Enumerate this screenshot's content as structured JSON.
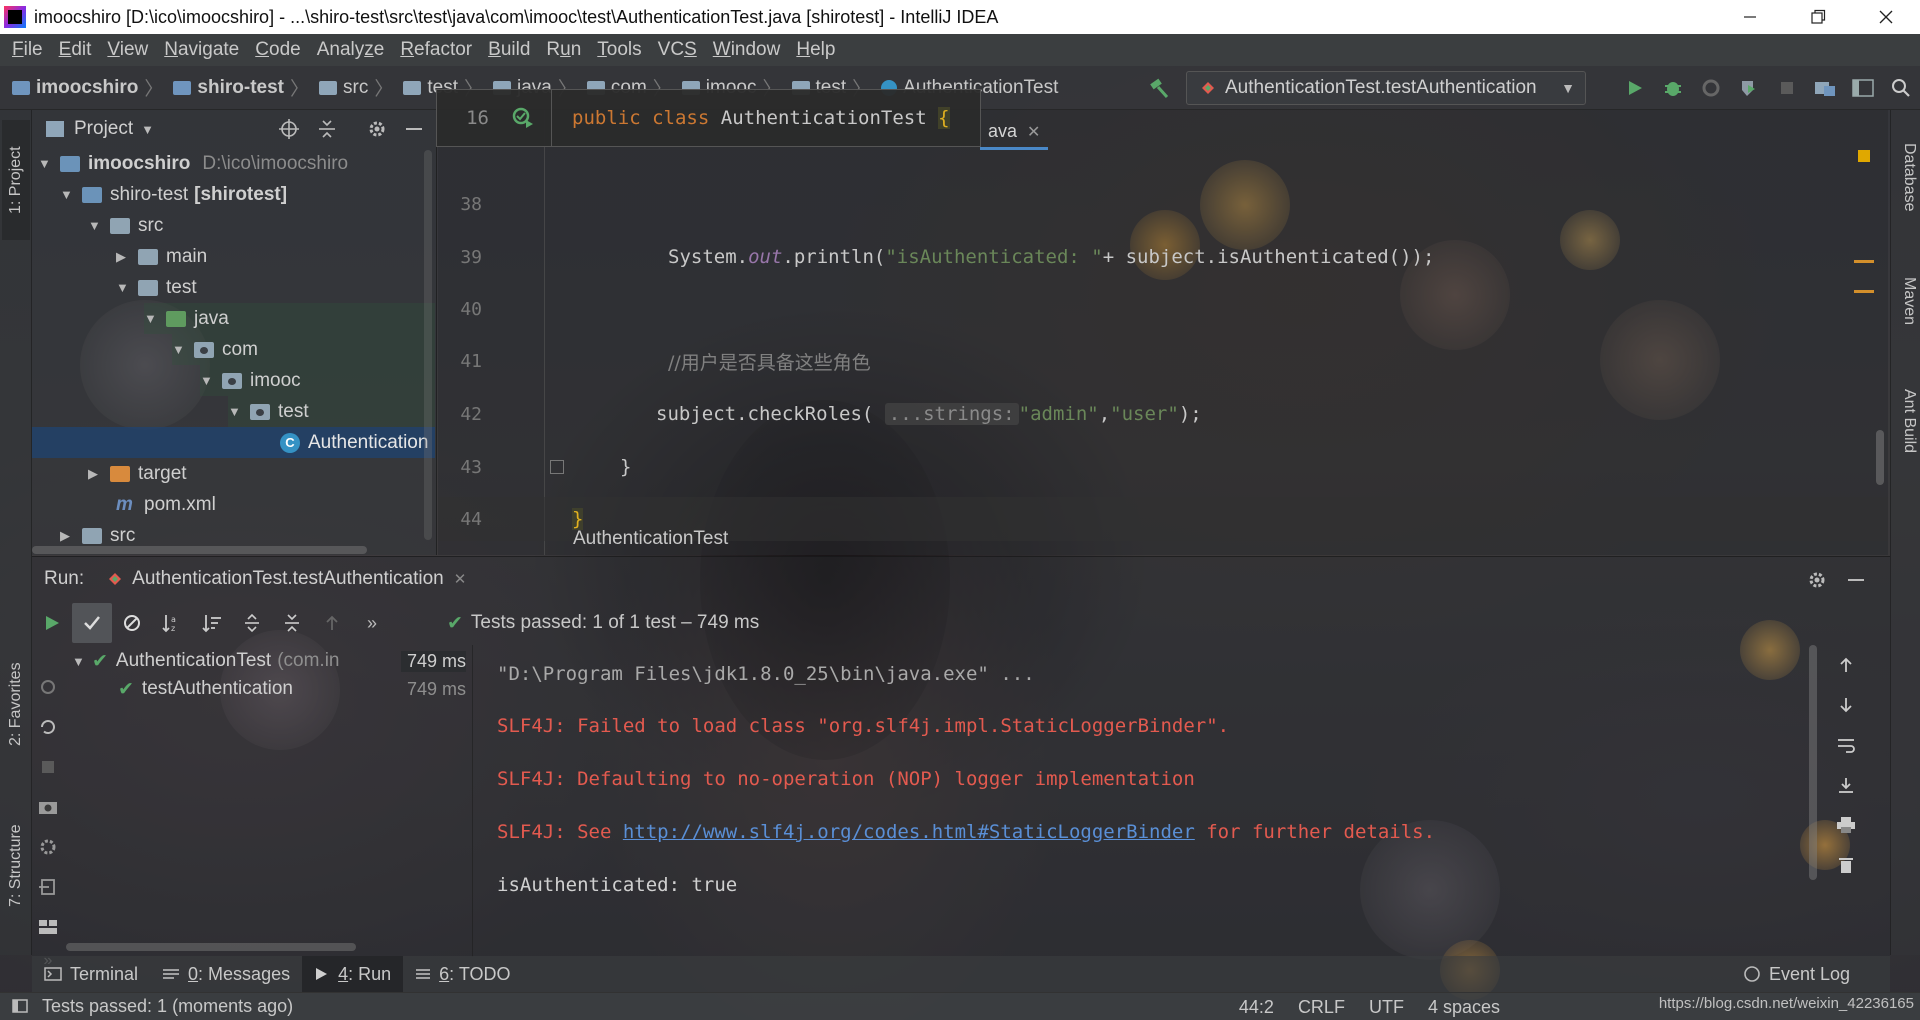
{
  "window": {
    "title": "imoocshiro [D:\\ico\\imoocshiro] - ...\\shiro-test\\src\\test\\java\\com\\imooc\\test\\AuthenticationTest.java [shirotest] - IntelliJ IDEA"
  },
  "menu": [
    {
      "mnemonic": "F",
      "rest": "ile"
    },
    {
      "mnemonic": "E",
      "rest": "dit"
    },
    {
      "mnemonic": "V",
      "rest": "iew"
    },
    {
      "mnemonic": "N",
      "rest": "avigate"
    },
    {
      "mnemonic": "C",
      "rest": "ode"
    },
    {
      "pre": "Analy",
      "mnemonic": "z",
      "rest": "e"
    },
    {
      "mnemonic": "R",
      "rest": "efactor"
    },
    {
      "mnemonic": "B",
      "rest": "uild"
    },
    {
      "pre": "R",
      "mnemonic": "u",
      "rest": "n"
    },
    {
      "mnemonic": "T",
      "rest": "ools"
    },
    {
      "pre": "VC",
      "mnemonic": "S",
      "rest": ""
    },
    {
      "mnemonic": "W",
      "rest": "indow"
    },
    {
      "mnemonic": "H",
      "rest": "elp"
    }
  ],
  "breadcrumbs": [
    "imoocshiro",
    "shiro-test",
    "src",
    "test",
    "java",
    "com",
    "imooc",
    "test",
    "AuthenticationTest"
  ],
  "run_config": "AuthenticationTest.testAuthentication",
  "left_tabs": {
    "project": "1: Project",
    "favorites": "2: Favorites",
    "structure": "7: Structure"
  },
  "right_tabs": {
    "database": "Database",
    "maven": "Maven",
    "ant": "Ant Build"
  },
  "project_panel": {
    "title": "Project",
    "tree": [
      {
        "label": "imoocshiro",
        "extra": "D:\\ico\\imoocshiro"
      },
      {
        "label": "shiro-test",
        "extra": "[shirotest]"
      },
      {
        "label": "src"
      },
      {
        "label": "main"
      },
      {
        "label": "test"
      },
      {
        "label": "java"
      },
      {
        "label": "com"
      },
      {
        "label": "imooc"
      },
      {
        "label": "test"
      },
      {
        "label": "Authentication"
      },
      {
        "label": "target"
      },
      {
        "label": "pom.xml"
      },
      {
        "label": "src"
      }
    ]
  },
  "editor": {
    "tab": "ava",
    "sticky": {
      "line": "16",
      "code": {
        "kw1": "public",
        "kw2": "class",
        "name": "AuthenticationTest",
        "brace": "{"
      }
    },
    "lines": [
      {
        "n": "38"
      },
      {
        "n": "39",
        "a": "System.",
        "b": "out",
        "c": ".println(",
        "d": "\"isAuthenticated: \"",
        "e": "+ subject.isAuthenticated());"
      },
      {
        "n": "40"
      },
      {
        "n": "41",
        "comment": "//用户是否具备这些角色"
      },
      {
        "n": "42",
        "a": "subject.checkRoles(",
        "hint": "...strings:",
        "s1": "\"admin\"",
        "comma": ",",
        "s2": "\"user\"",
        "end": ");"
      },
      {
        "n": "43",
        "code": "}"
      },
      {
        "n": "44",
        "code": "}"
      }
    ],
    "breadcrumb": "AuthenticationTest"
  },
  "run_panel": {
    "label": "Run:",
    "tab": "AuthenticationTest.testAuthentication",
    "status": "Tests passed: 1 of 1 test – 749 ms",
    "tree": [
      {
        "label": "AuthenticationTest",
        "extra": "(com.in",
        "ms": "749 ms"
      },
      {
        "label": "testAuthentication",
        "ms": "749 ms"
      }
    ],
    "console": {
      "cmd": "\"D:\\Program Files\\jdk1.8.0_25\\bin\\java.exe\" ...",
      "err1": "SLF4J: Failed to load class \"org.slf4j.impl.StaticLoggerBinder\".",
      "err2": "SLF4J: Defaulting to no-operation (NOP) logger implementation",
      "err3_pre": "SLF4J: See ",
      "err3_link": "http://www.slf4j.org/codes.html#StaticLoggerBinder",
      "err3_post": " for further details.",
      "out": "isAuthenticated: true"
    }
  },
  "bottom_tabs": [
    {
      "label": "Terminal"
    },
    {
      "num": "0",
      "label": ": Messages"
    },
    {
      "num": "4",
      "label": ": Run"
    },
    {
      "num": "6",
      "label": ": TODO"
    }
  ],
  "event_log": "Event Log",
  "statusbar": {
    "message": "Tests passed: 1 (moments ago)",
    "position": "44:2",
    "line_sep": "CRLF",
    "encoding": "UTF",
    "indent": "4 spaces",
    "watermark": "https://blog.csdn.net/weixin_42236165"
  },
  "colors": {
    "keyword": "#cc7832",
    "string": "#6a8759",
    "error": "#e35a4f",
    "link": "#5a8fd6",
    "success": "#59a869"
  }
}
